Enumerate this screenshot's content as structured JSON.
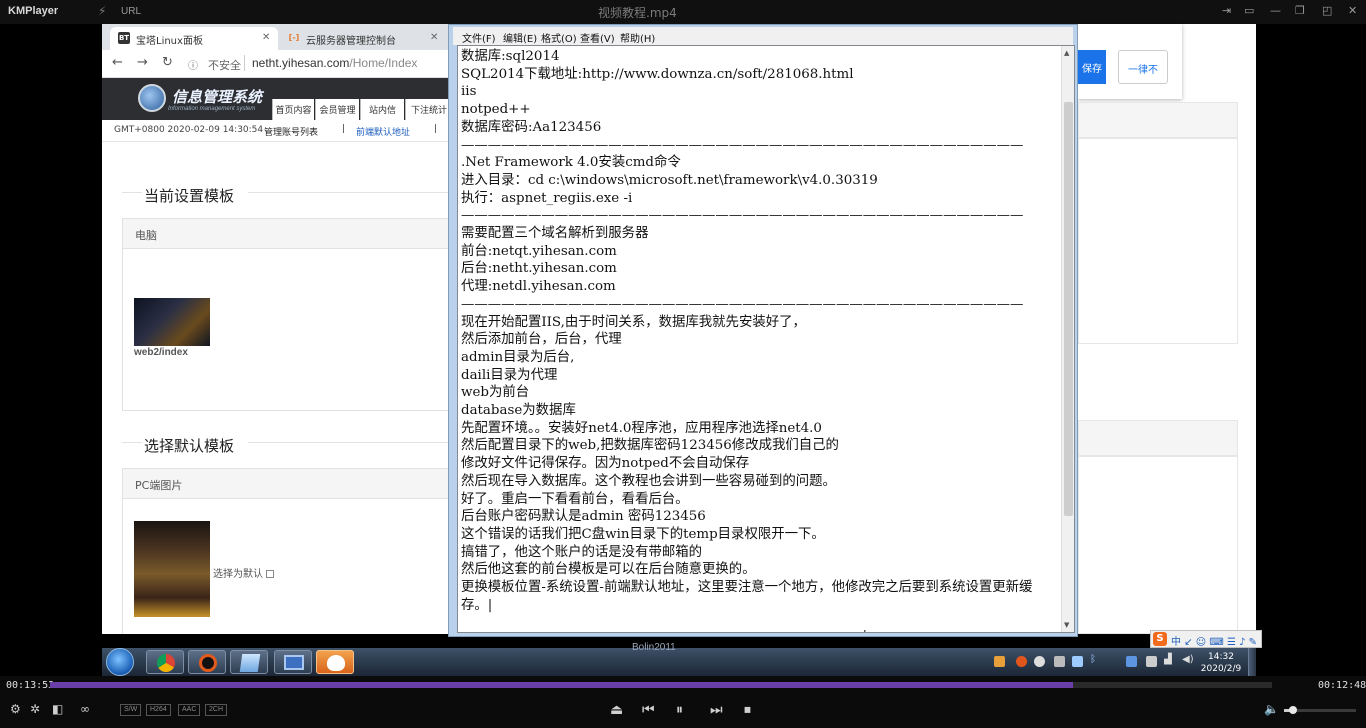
{
  "player": {
    "app_name": "KMPlayer",
    "url_label": "URL",
    "file_title": "视频教程.mp4",
    "time_elapsed": "00:13:53",
    "time_total": "00:12:48",
    "progress_fraction": 0.837,
    "volume_fraction": 0.12,
    "badges": [
      "S/W",
      "H264",
      "AAC",
      "2CH"
    ],
    "subtitle_text": "Bolin2011"
  },
  "browser": {
    "tabs": [
      {
        "label": "宝塔Linux面板",
        "icon": "BT"
      },
      {
        "label": "云服务器管理控制台",
        "icon": "[-]"
      }
    ],
    "security_label": "不安全",
    "url_host": "netht.yihesan.com",
    "url_path": "/Home/Index",
    "site": {
      "logo_text": "信息管理系统",
      "logo_sub": "Information management system",
      "nav": [
        "首页内容",
        "会员管理",
        "站内信",
        "下注统计"
      ],
      "timestamp": "GMT+0800 2020-02-09 14:30:54",
      "link1": "管理账号列表",
      "link2": "前端默认地址",
      "section1_title": "当前设置模板",
      "panel1_head": "电脑",
      "template1_name": "web2/index",
      "section2_title": "选择默认模板",
      "panel2_head": "PC端图片",
      "select_default_label": "选择为默认"
    }
  },
  "notepad": {
    "menu": [
      "文件(F)",
      "编辑(E)",
      "格式(O)",
      "查看(V)",
      "帮助(H)"
    ],
    "content": "数据库:sql2014\nSQL2014下载地址:http://www.downza.cn/soft/281068.html\niis\nnotped++\n数据库密码:Aa123456\n——————————————————————————————————————————\n.Net Framework 4.0安装cmd命令\n进入目录：cd c:\\windows\\microsoft.net\\framework\\v4.0.30319\n执行：aspnet_regiis.exe -i\n——————————————————————————————————————————\n需要配置三个域名解析到服务器\n前台:netqt.yihesan.com\n后台:netht.yihesan.com\n代理:netdl.yihesan.com\n——————————————————————————————————————————\n现在开始配置IIS,由于时间关系，数据库我就先安装好了，\n然后添加前台，后台，代理\nadmin目录为后台,\ndaili目录为代理\nweb为前台\ndatabase为数据库\n先配置环境。。安装好net4.0程序池，应用程序池选择net4.0\n然后配置目录下的web,把数据库密码123456修改成我们自己的\n修改好文件记得保存。因为notped不会自动保存\n然后现在导入数据库。这个教程也会讲到一些容易碰到的问题。\n好了。重启一下看看前台，看看后台。\n后台账户密码默认是admin 密码123456\n这个错误的话我们把C盘win目录下的temp目录权限开一下。\n搞错了，他这个账户的话是没有带邮箱的\n然后他这套的前台模板是可以在后台随意更换的。\n更换模板位置-系统设置-前端默认地址，这里要注意一个地方，他修改完之后要到系统设置更新缓存。|"
  },
  "rightapp": {
    "button1": "保存",
    "button2": "一律不"
  },
  "taskbar": {
    "clock_time": "14:32",
    "clock_date": "2020/2/9"
  },
  "colors": {
    "progress": "#6b3fa8",
    "notepad_frame": "#b9d1ea",
    "site_header": "#2c2e31"
  }
}
